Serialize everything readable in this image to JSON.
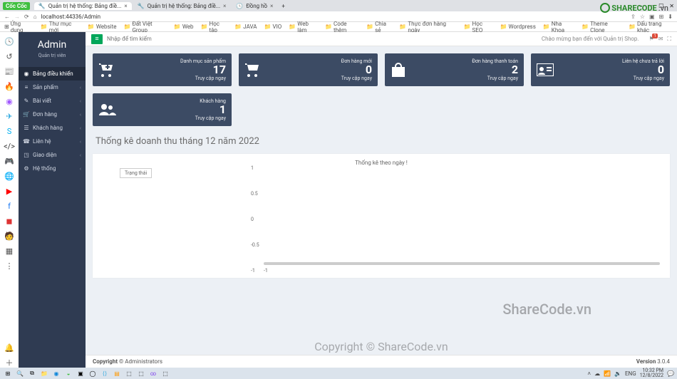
{
  "browser": {
    "brand": "Cốc Cốc",
    "tabs": [
      {
        "title": "Quản trị hệ thống: Bảng điề..."
      },
      {
        "title": "Quản trị hệ thống: Bảng điề..."
      },
      {
        "title": "Đồng hồ"
      }
    ],
    "url": "localhost:44336/Admin",
    "bookmarks": [
      "Ứng dụng",
      "Thư mục mới",
      "Website",
      "Đất Việt Group",
      "Web",
      "Học tập",
      "JAVA",
      "VIO",
      "Web làm",
      "Code thêm",
      "Chia sẻ",
      "Thực đơn hàng ngày",
      "Học SEO",
      "Wordpress",
      "Nha Khoa",
      "Theme Clone"
    ],
    "bookmark_right": "Dấu trang khác"
  },
  "logo": {
    "text": "SHARECODE",
    "suffix": ".vn"
  },
  "admin": {
    "title": "Admin",
    "subtitle": "Quản trị viên",
    "nav": [
      {
        "label": "Bảng điều khiển",
        "active": true,
        "icon": "◉"
      },
      {
        "label": "Sản phẩm",
        "icon": "≡",
        "sub": true
      },
      {
        "label": "Bài viết",
        "icon": "✎",
        "sub": true
      },
      {
        "label": "Đơn hàng",
        "icon": "🛒",
        "sub": true
      },
      {
        "label": "Khách hàng",
        "icon": "☰",
        "sub": true
      },
      {
        "label": "Liên hệ",
        "icon": "☎",
        "sub": true
      },
      {
        "label": "Giao diện",
        "icon": "◳",
        "sub": true
      },
      {
        "label": "Hệ thống",
        "icon": "⚙",
        "sub": true
      }
    ]
  },
  "topbar": {
    "search_placeholder": "Nhập để tìm kiếm",
    "welcome": "Chào mừng bạn đến với Quản trị Shop.",
    "badge1": "1"
  },
  "cards": [
    {
      "label": "Danh mục sản phẩm",
      "value": "17",
      "sub": "Truy cập ngay"
    },
    {
      "label": "Đơn hàng mới",
      "value": "0",
      "sub": "Truy cập ngay"
    },
    {
      "label": "Đơn hàng thanh toán",
      "value": "2",
      "sub": "Truy cập ngay"
    },
    {
      "label": "Liên hệ chưa trả lời",
      "value": "0",
      "sub": "Truy cập ngay"
    },
    {
      "label": "Khách hàng",
      "value": "1",
      "sub": "Truy cập ngay"
    }
  ],
  "stats_title": "Thống kê doanh thu tháng 12 năm 2022",
  "chart_data": {
    "type": "line",
    "title": "Thống kê theo ngày !",
    "legend": "Trạng thái",
    "ylim": [
      -1,
      1
    ],
    "yticks": [
      1,
      0.5,
      0,
      -0.5,
      -1
    ],
    "x": [
      -1
    ],
    "series": []
  },
  "footer": {
    "copyright": "Copyright © Administrators",
    "version_label": "Version",
    "version": "3.0.4"
  },
  "watermarks": {
    "big": "ShareCode.vn",
    "bottom": "Copyright © ShareCode.vn"
  },
  "system": {
    "lang": "ENG",
    "time": "10:32 PM",
    "date": "12/8/2022"
  }
}
